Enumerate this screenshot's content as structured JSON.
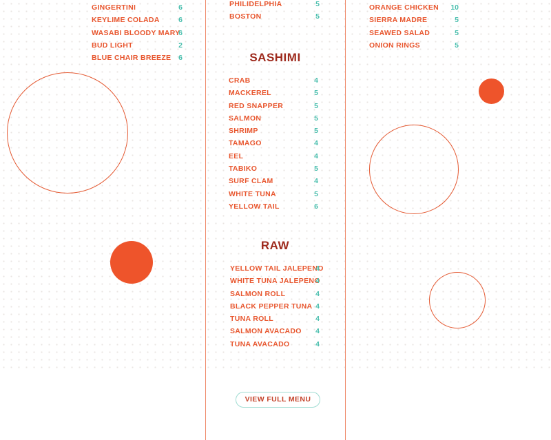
{
  "left_column": {
    "items": [
      {
        "name": "GINGERTINI",
        "price": "6"
      },
      {
        "name": "KEYLIME COLADA",
        "price": "6"
      },
      {
        "name": "WASABI BLOODY MARY",
        "price": "6"
      },
      {
        "name": "BUD LIGHT",
        "price": "2"
      },
      {
        "name": "BLUE CHAIR BREEZE",
        "price": "6"
      }
    ]
  },
  "center_column": {
    "top_items": [
      {
        "name": "PHILIDELPHIA",
        "price": "5"
      },
      {
        "name": "BOSTON",
        "price": "5"
      }
    ],
    "sashimi": {
      "title": "SASHIMI",
      "items": [
        {
          "name": "CRAB",
          "price": "4"
        },
        {
          "name": "MACKEREL",
          "price": "5"
        },
        {
          "name": "RED SNAPPER",
          "price": "5"
        },
        {
          "name": "SALMON",
          "price": "5"
        },
        {
          "name": "SHRIMP",
          "price": "5"
        },
        {
          "name": "TAMAGO",
          "price": "4"
        },
        {
          "name": "EEL",
          "price": "4"
        },
        {
          "name": "TABIKO",
          "price": "5"
        },
        {
          "name": "SURF CLAM",
          "price": "4"
        },
        {
          "name": "WHITE TUNA",
          "price": "5"
        },
        {
          "name": "YELLOW TAIL",
          "price": "6"
        }
      ]
    },
    "raw": {
      "title": "RAW",
      "items": [
        {
          "name": "YELLOW TAIL JALEPENO",
          "price": "4"
        },
        {
          "name": "WHITE TUNA JALEPENO",
          "price": "4"
        },
        {
          "name": "SALMON ROLL",
          "price": "4"
        },
        {
          "name": "BLACK PEPPER TUNA",
          "price": "4"
        },
        {
          "name": "TUNA ROLL",
          "price": "4"
        },
        {
          "name": "SALMON AVACADO",
          "price": "4"
        },
        {
          "name": "TUNA AVACADO",
          "price": "4"
        }
      ]
    },
    "view_full_menu_label": "VIEW FULL MENU"
  },
  "right_column": {
    "items": [
      {
        "name": "ORANGE CHICKEN",
        "price": "10"
      },
      {
        "name": "SIERRA MADRE",
        "price": "5"
      },
      {
        "name": "SEAWED SALAD",
        "price": "5"
      },
      {
        "name": "ONION RINGS",
        "price": "5"
      }
    ]
  },
  "colors": {
    "item_name": "#e8562e",
    "price": "#4bbfae",
    "section_title": "#9e2a1d",
    "accent_circle": "#ee542b",
    "column_divider": "#ef8a6b"
  }
}
